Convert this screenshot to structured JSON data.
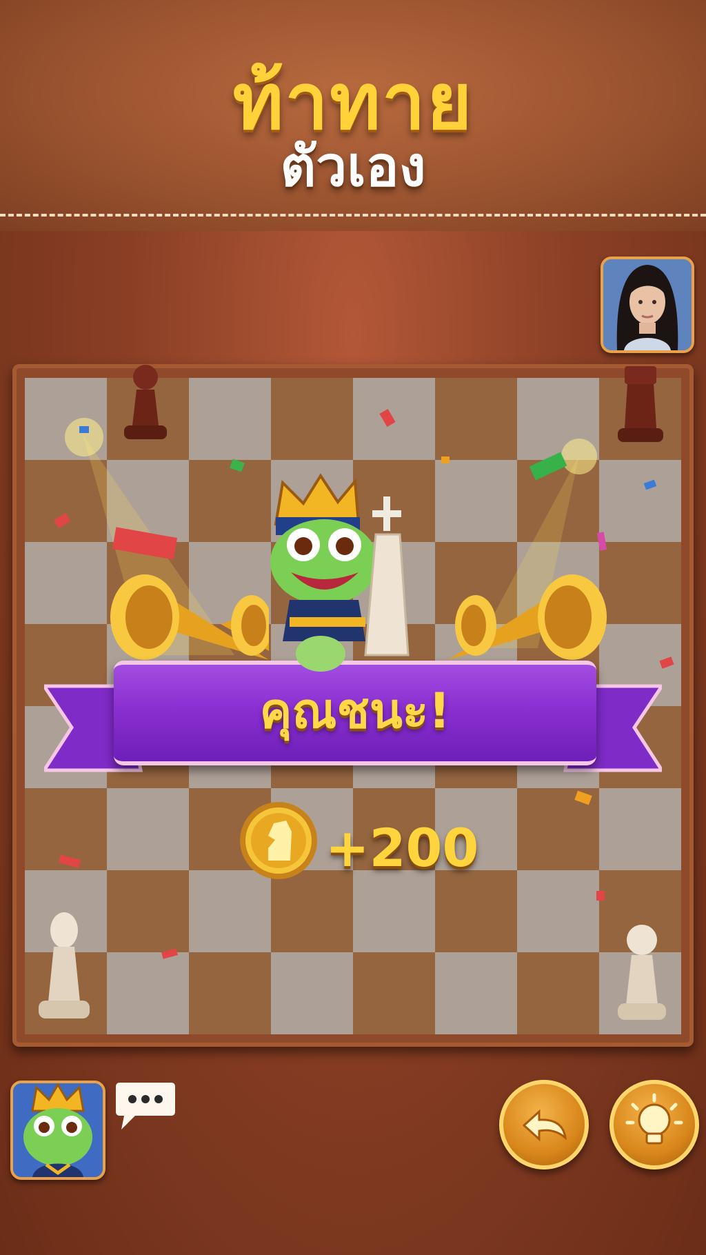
{
  "header": {
    "title": "ท้าทาย",
    "subtitle": "ตัวเอง"
  },
  "result": {
    "banner_text": "คุณชนะ!",
    "reward_text": "+200",
    "coin_icon": "knight-coin-icon"
  },
  "opponent": {
    "avatar": "woman-avatar"
  },
  "player": {
    "avatar": "frog-king-avatar",
    "chat_icon": "chat-dots-icon"
  },
  "controls": {
    "undo_icon": "undo-arrow-icon",
    "hint_icon": "lightbulb-icon"
  },
  "colors": {
    "title_gold": "#ffd23a",
    "ribbon_purple": "#8a2fd1",
    "board_light": "#e8dcd0",
    "board_dark": "#c58a56",
    "button_gold": "#d8871a"
  }
}
